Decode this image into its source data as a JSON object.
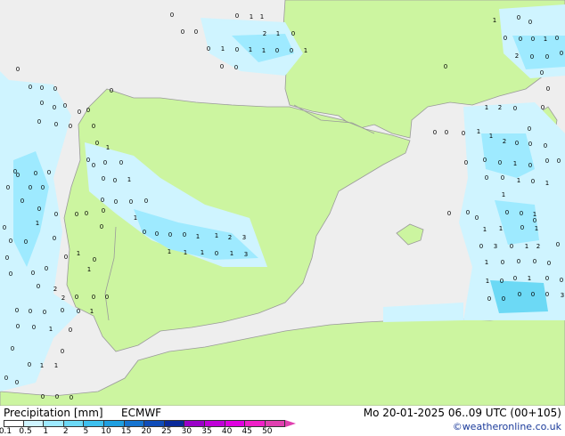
{
  "header": {
    "title": "Precipitation [mm]",
    "model": "ECMWF",
    "datetime": "Mo 20-01-2025 06..09 UTC (00+105)",
    "credit": "©weatheronline.co.uk"
  },
  "legend": {
    "labels": [
      "0.1",
      "0.5",
      "1",
      "2",
      "5",
      "10",
      "15",
      "20",
      "25",
      "30",
      "35",
      "40",
      "45",
      "50"
    ],
    "colors": [
      "#ffffff",
      "#cff4ff",
      "#9eeaff",
      "#6cd9f5",
      "#3ec0ee",
      "#1f9fe0",
      "#1674d0",
      "#0f4cb8",
      "#0a2a9a",
      "#9a00c8",
      "#c000d8",
      "#e000e0",
      "#f020c8",
      "#e040b0"
    ]
  },
  "map": {
    "colors": {
      "sea": "#eeeeee",
      "land": "#ccf5a0",
      "precip_light": "#cff4ff",
      "precip_mid": "#9eeaff",
      "precip_heavy": "#6cd9f5",
      "border": "#9a9a9a"
    },
    "values": [
      "0",
      "0",
      "0",
      "0",
      "1",
      "1",
      "2",
      "1",
      "0",
      "0",
      "1",
      "0",
      "1",
      "1",
      "0",
      "0",
      "1",
      "0",
      "0",
      "0",
      "0",
      "0",
      "0",
      "0",
      "0",
      "0",
      "0",
      "0",
      "0",
      "0",
      "0",
      "0",
      "0",
      "0",
      "1",
      "0",
      "0",
      "0",
      "0",
      "0",
      "0",
      "1",
      "0",
      "0",
      "0",
      "0",
      "0",
      "0",
      "0",
      "0",
      "0",
      "0",
      "0",
      "0",
      "0",
      "0",
      "0",
      "0",
      "0",
      "0",
      "0",
      "1",
      "0",
      "0",
      "0",
      "0",
      "0",
      "1",
      "0",
      "0",
      "0",
      "0",
      "1",
      "1",
      "0",
      "0",
      "0",
      "0",
      "1",
      "1",
      "2",
      "3",
      "1",
      "1",
      "1",
      "0",
      "1",
      "3",
      "0",
      "2",
      "2",
      "0",
      "0",
      "0",
      "0",
      "0",
      "0",
      "0",
      "0",
      "1",
      "0",
      "0",
      "1",
      "0",
      "0",
      "0",
      "0",
      "1",
      "1",
      "0",
      "0",
      "0",
      "0",
      "0",
      "0",
      "1",
      "0",
      "0",
      "0",
      "0",
      "0",
      "1",
      "0",
      "2",
      "0",
      "0",
      "0",
      "0",
      "1",
      "2",
      "0",
      "0",
      "0",
      "0",
      "0",
      "0",
      "1",
      "1",
      "0",
      "2",
      "0",
      "0",
      "0",
      "0",
      "0",
      "0",
      "1",
      "0",
      "0",
      "0",
      "0",
      "0",
      "1",
      "0",
      "1",
      "1",
      "0",
      "0",
      "0",
      "0",
      "1",
      "0",
      "0",
      "1",
      "1",
      "0",
      "1",
      "0",
      "3",
      "0",
      "1",
      "2",
      "0",
      "1",
      "0",
      "0",
      "0",
      "0",
      "1",
      "0",
      "0",
      "1",
      "0",
      "0",
      "0",
      "0",
      "0",
      "0",
      "0",
      "3",
      "1",
      "0",
      "2",
      "0",
      "0",
      "0",
      "0",
      "1",
      "0",
      "0",
      "0",
      "1",
      "1",
      "1",
      "2",
      "0",
      "1",
      "1",
      "3",
      "0",
      "0",
      "0",
      "1"
    ]
  }
}
